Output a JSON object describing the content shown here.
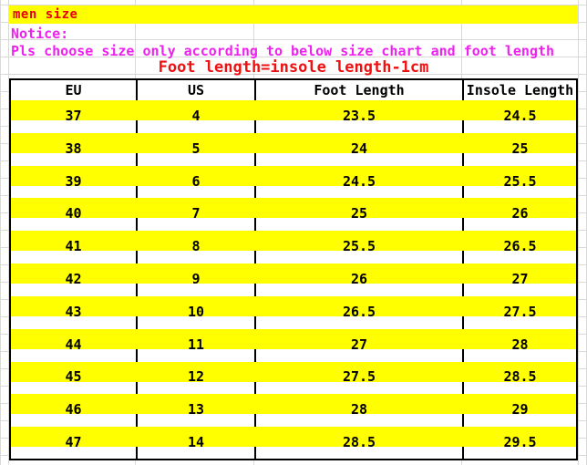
{
  "banner": {
    "text": "men size",
    "background_color": "#ffff00",
    "text_color": "#e8000d"
  },
  "notice": {
    "label": "Notice:",
    "body": "Pls choose size only according to below size chart and foot length",
    "text_color": "#ee22ee"
  },
  "formula": {
    "text": "Foot length=insole length-1cm",
    "text_color": "#ee1111"
  },
  "chart_data": {
    "type": "table",
    "title": "men size",
    "columns": [
      "EU",
      "US",
      "Foot Length",
      "Insole Length"
    ],
    "rows": [
      [
        "37",
        "4",
        "23.5",
        "24.5"
      ],
      [
        "38",
        "5",
        "24",
        "25"
      ],
      [
        "39",
        "6",
        "24.5",
        "25.5"
      ],
      [
        "40",
        "7",
        "25",
        "26"
      ],
      [
        "41",
        "8",
        "25.5",
        "26.5"
      ],
      [
        "42",
        "9",
        "26",
        "27"
      ],
      [
        "43",
        "10",
        "26.5",
        "27.5"
      ],
      [
        "44",
        "11",
        "27",
        "28"
      ],
      [
        "45",
        "12",
        "27.5",
        "28.5"
      ],
      [
        "46",
        "13",
        "28",
        "29"
      ],
      [
        "47",
        "14",
        "28.5",
        "29.5"
      ]
    ],
    "highlight_color": "#ffff00",
    "border_color": "#000000",
    "xlabel": "",
    "ylabel": ""
  }
}
